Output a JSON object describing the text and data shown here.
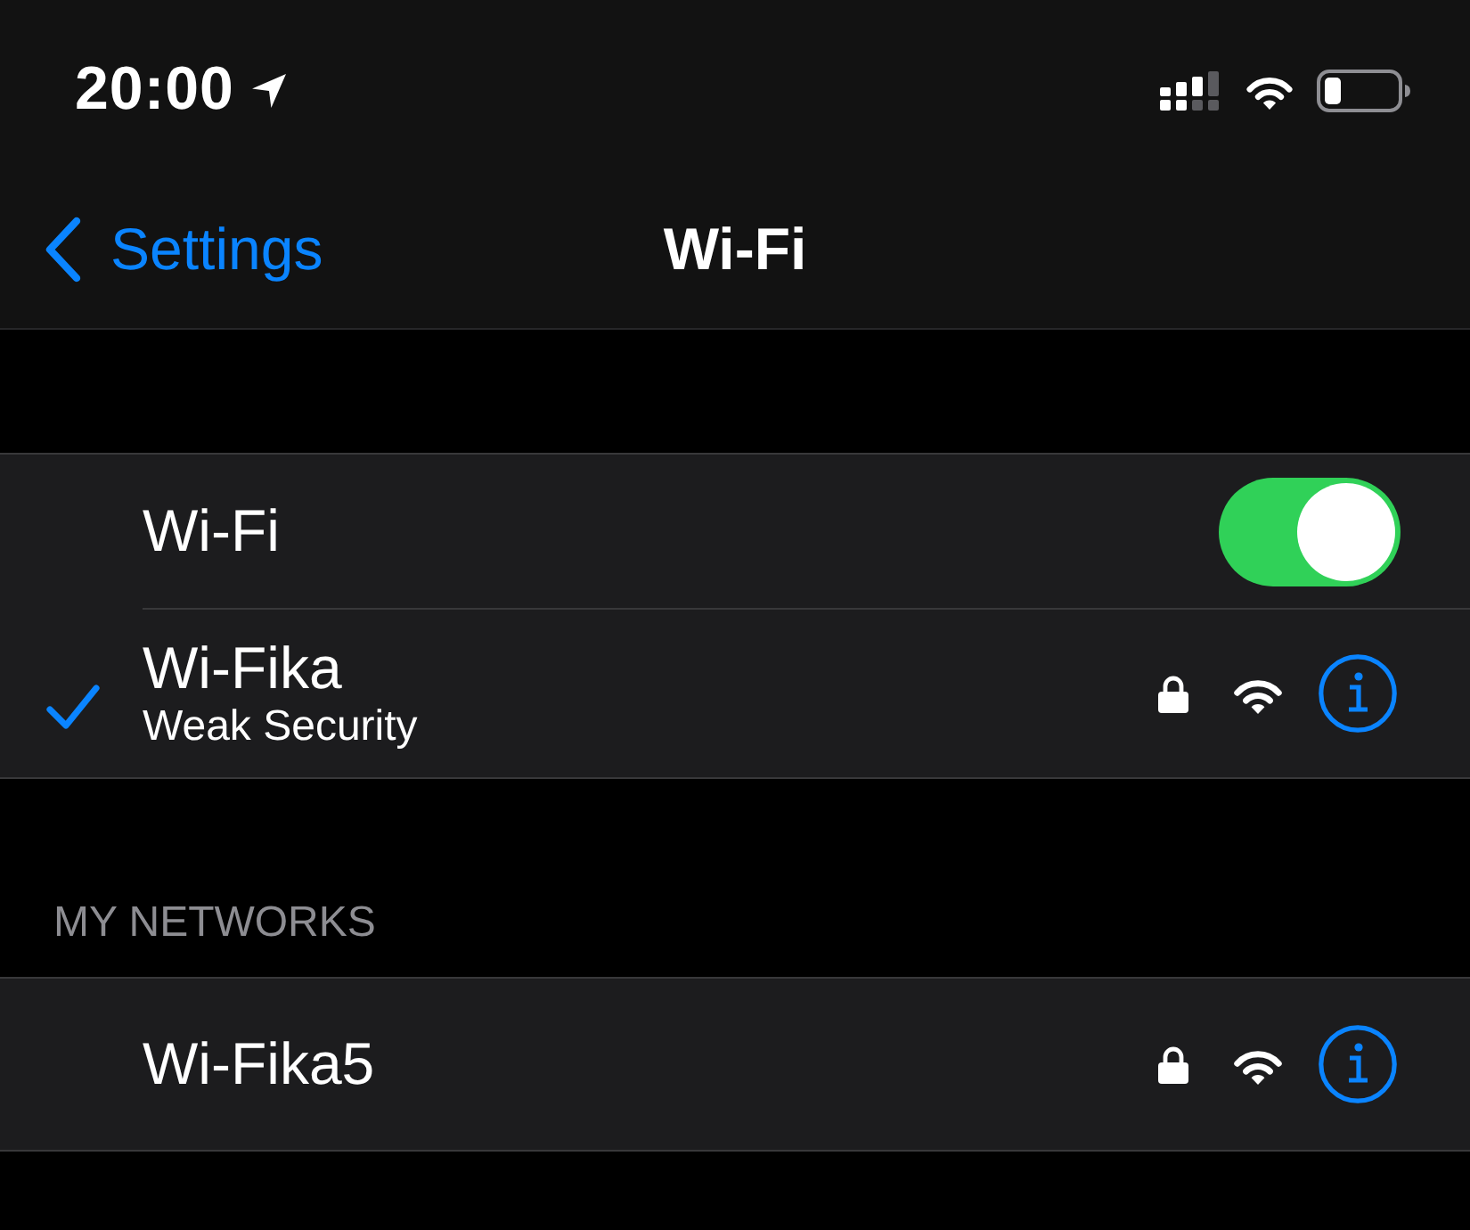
{
  "status_bar": {
    "time": "20:00"
  },
  "nav_bar": {
    "back_label": "Settings",
    "title": "Wi-Fi"
  },
  "wifi_switch": {
    "label": "Wi-Fi",
    "on": true
  },
  "connected_network": {
    "name": "Wi-Fika",
    "subtitle": "Weak Security",
    "selected": true,
    "secured": true
  },
  "my_networks": {
    "header": "MY NETWORKS",
    "items": [
      {
        "name": "Wi-Fika5",
        "selected": false,
        "secured": true
      }
    ]
  }
}
